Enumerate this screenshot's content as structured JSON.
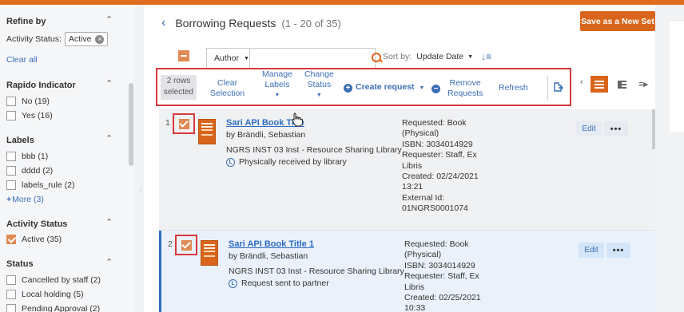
{
  "colors": {
    "accent": "#d9651c",
    "link": "#3b6fb6",
    "highlight_border": "#d9383b",
    "selected_row_bg": "#eaf1fa"
  },
  "sidebar": {
    "refine_by": "Refine by",
    "activity_status_label": "Activity Status:",
    "activity_status_chip": "Active",
    "clear_all": "Clear all",
    "groups": [
      {
        "title": "Rapido Indicator",
        "items": [
          "No (19)",
          "Yes (16)"
        ]
      },
      {
        "title": "Labels",
        "items": [
          "bbb (1)",
          "dddd (2)",
          "labels_rule (2)"
        ],
        "more": "More (3)"
      },
      {
        "title": "Activity Status",
        "items": [
          "Active (35)"
        ]
      },
      {
        "title": "Status",
        "items": [
          "Cancelled by staff (2)",
          "Local holding (5)",
          "Pending Approval (2)"
        ]
      }
    ]
  },
  "header": {
    "title": "Borrowing Requests",
    "count": "(1 - 20 of 35)",
    "save_button": "Save as a New Set"
  },
  "search": {
    "scope": "Author",
    "value": ""
  },
  "sort": {
    "label": "Sort by:",
    "value": "Update Date"
  },
  "toolbar": {
    "selected_line1": "2 rows",
    "selected_line2": "selected",
    "clear_line1": "Clear",
    "clear_line2": "Selection",
    "labels_line1": "Manage",
    "labels_line2": "Labels",
    "status_line1": "Change",
    "status_line2": "Status",
    "create": "Create request",
    "remove_line1": "Remove",
    "remove_line2": "Requests",
    "refresh": "Refresh"
  },
  "rows": [
    {
      "num": "1",
      "title": "Sari API Book Title",
      "author": "by Brändli, Sebastian",
      "library": "NGRS INST 03 Inst - Resource Sharing Library",
      "status": "Physically received by library",
      "details": [
        "Requested: Book",
        "(Physical)",
        "ISBN: 3034014929",
        "Requester: Staff, Ex",
        "Libris",
        "Created: 02/24/2021",
        "13:21",
        "External Id:",
        "01NGRS0001074"
      ],
      "edit": "Edit",
      "more": "•••"
    },
    {
      "num": "2",
      "title": "Sari API Book Title 1",
      "author": "by Brändli, Sebastian",
      "library": "NGRS INST 03 Inst - Resource Sharing Library",
      "status": "Request sent to partner",
      "details": [
        "Requested: Book",
        "(Physical)",
        "ISBN: 3034014929",
        "Requester: Staff, Ex",
        "Libris",
        "Created: 02/25/2021",
        "10:33"
      ],
      "edit": "Edit",
      "more": "•••"
    }
  ],
  "icons": [
    "chevron-up-icon",
    "back-chevron-icon",
    "search-icon",
    "sort-direction-icon",
    "plus-circle-icon",
    "minus-circle-icon",
    "export-icon",
    "list-view-icon",
    "split-view-icon",
    "clock-icon",
    "more-icon"
  ]
}
